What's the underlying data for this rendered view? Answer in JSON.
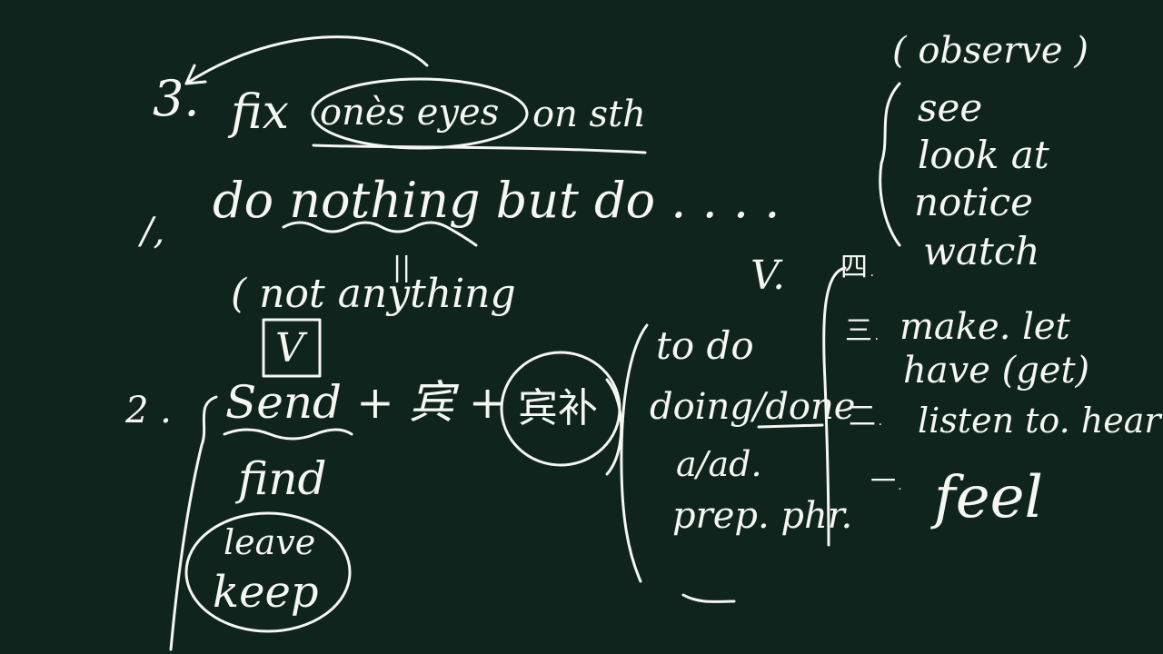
{
  "background_color": "#0f241d",
  "ink_color": "#f6f6f2",
  "lines": {
    "fix_number": "3.",
    "fix_word": "fix",
    "fix_ones_eyes": "onès eyes",
    "fix_on_sth": "on sth",
    "do_nothing_marker": "/,",
    "do_nothing": "do nothing but do . . . .",
    "not_anything": "( not anything",
    "not_anything_mark": "||",
    "boxed_v": "V",
    "send_number": "2 .",
    "send_phrase": "Send + 宾 +",
    "send_complement": "宾补",
    "find": "find",
    "leave": "leave",
    "keep": "keep"
  },
  "complement_forms": [
    "to do",
    "doing/done",
    "a/ad.",
    "prep. phr."
  ],
  "verbs_header": "V.",
  "perception_verbs": [
    "( observe )",
    "see",
    "look at",
    "notice",
    "watch"
  ],
  "numbered_groups": [
    {
      "num": "四.",
      "text": ""
    },
    {
      "num": "三.",
      "text": "make. let"
    },
    {
      "num": "",
      "text": "have (get)"
    },
    {
      "num": "二.",
      "text": "listen to. hear"
    },
    {
      "num": "一.",
      "text": "feel"
    }
  ]
}
